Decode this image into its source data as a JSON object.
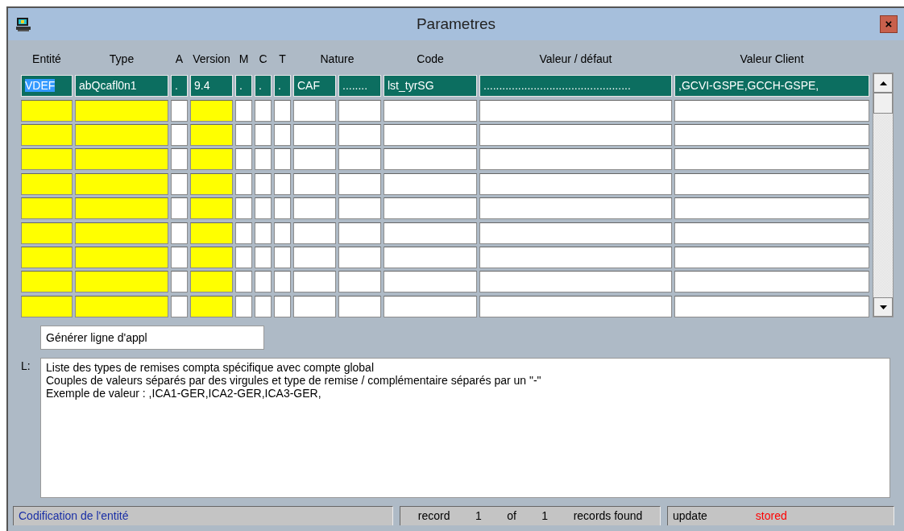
{
  "window": {
    "title": "Parametres",
    "close_glyph": "×"
  },
  "table": {
    "headers": [
      {
        "label": "Entité",
        "kind": "single"
      },
      {
        "label": "Type",
        "kind": "single"
      },
      {
        "label": "A",
        "kind": "single"
      },
      {
        "label": "Version",
        "kind": "single"
      },
      {
        "label": "M",
        "kind": "single"
      },
      {
        "label": "C",
        "kind": "single"
      },
      {
        "label": "T",
        "kind": "single"
      },
      {
        "label": "Nature",
        "kind": "double"
      },
      {
        "label": "Code",
        "kind": "single"
      },
      {
        "label": "Valeur / défaut",
        "kind": "single"
      },
      {
        "label": "Valeur Client",
        "kind": "single"
      }
    ],
    "columns": [
      {
        "required": true
      },
      {
        "required": true
      },
      {
        "required": false
      },
      {
        "required": true
      },
      {
        "required": false
      },
      {
        "required": false
      },
      {
        "required": false
      },
      {
        "required": false
      },
      {
        "required": false
      },
      {
        "required": false
      },
      {
        "required": false
      },
      {
        "required": false
      }
    ],
    "rows": [
      {
        "selected": true,
        "cells": [
          {
            "text": "VDEF",
            "text_selected": true
          },
          {
            "text": "abQcafl0n1",
            "text_selected": false
          },
          {
            "text": ".",
            "text_selected": false
          },
          {
            "text": "9.4",
            "text_selected": false
          },
          {
            "text": ".",
            "text_selected": false
          },
          {
            "text": ".",
            "text_selected": false
          },
          {
            "text": ".",
            "text_selected": false
          },
          {
            "text": "CAF",
            "text_selected": false
          },
          {
            "text": "........",
            "text_selected": false
          },
          {
            "text": "lst_tyrSG",
            "text_selected": false
          },
          {
            "text": "...............................................",
            "text_selected": false
          },
          {
            "text": ",GCVI-GSPE,GCCH-GSPE,",
            "text_selected": false
          }
        ]
      },
      {
        "selected": false
      },
      {
        "selected": false
      },
      {
        "selected": false
      },
      {
        "selected": false
      },
      {
        "selected": false
      },
      {
        "selected": false
      },
      {
        "selected": false
      },
      {
        "selected": false
      },
      {
        "selected": false
      }
    ]
  },
  "action_field": {
    "value": "Générer ligne d'appl"
  },
  "description": {
    "label": "L:",
    "lines": [
      "Liste des types de remises compta spécifique avec compte global",
      "Couples de valeurs séparés par des virgules et type de remise / complémentaire séparés par un \"-\"",
      "Exemple de valeur : ,ICA1-GER,ICA2-GER,ICA3-GER,"
    ]
  },
  "status_bar": {
    "hint": "Codification de l'entité",
    "record_label": "record",
    "record_number": "1",
    "of_label": "of",
    "record_total": "1",
    "found_label": "records found",
    "mode_label": "update",
    "mode_value": "stored"
  }
}
